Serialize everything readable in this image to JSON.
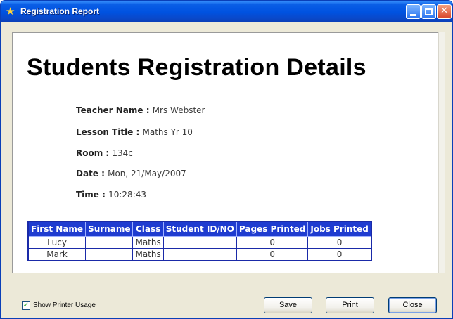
{
  "window": {
    "title": "Registration Report",
    "icon": "star-icon"
  },
  "report": {
    "heading": "Students Registration Details",
    "fields": [
      {
        "label": "Teacher Name",
        "value": "Mrs Webster"
      },
      {
        "label": "Lesson Title",
        "value": "Maths Yr 10"
      },
      {
        "label": "Room",
        "value": "134c"
      },
      {
        "label": "Date",
        "value": "Mon, 21/May/2007"
      },
      {
        "label": "Time",
        "value": "10:28:43"
      }
    ],
    "table": {
      "headers": [
        "First Name",
        "Surname",
        "Class",
        "Student ID/NO",
        "Pages Printed",
        "Jobs Printed"
      ],
      "rows": [
        [
          "Lucy",
          "",
          "Maths",
          "",
          "0",
          "0"
        ],
        [
          "Mark",
          "",
          "Maths",
          "",
          "0",
          "0"
        ]
      ]
    }
  },
  "footer": {
    "show_printer_usage_label": "Show Printer Usage",
    "show_printer_usage_checked": true,
    "save_label": "Save",
    "print_label": "Print",
    "close_label": "Close"
  },
  "colors": {
    "title_bar": "#0052e0",
    "table_header": "#1f3cd0",
    "table_border": "#1a2aa8"
  }
}
